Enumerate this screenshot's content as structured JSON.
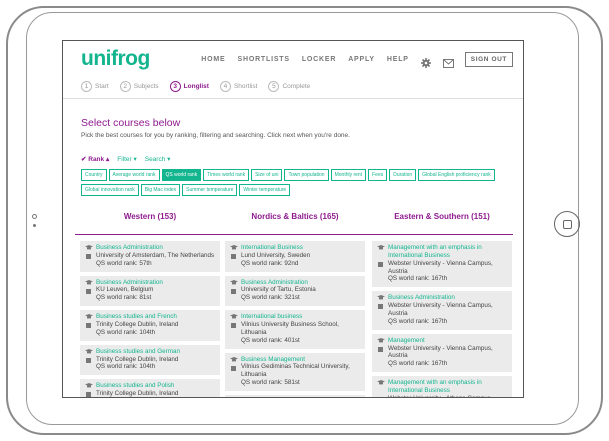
{
  "app": {
    "logo": "unifrog",
    "accent_color": "#13b58f",
    "secondary_color": "#8e1b8e"
  },
  "nav": {
    "items": [
      "HOME",
      "SHORTLISTS",
      "LOCKER",
      "APPLY",
      "HELP"
    ],
    "icons": [
      "gear-icon",
      "mail-icon"
    ],
    "signout": "SIGN OUT"
  },
  "steps": [
    {
      "num": "1",
      "label": "Start"
    },
    {
      "num": "2",
      "label": "Subjects"
    },
    {
      "num": "3",
      "label": "Longlist",
      "active": true
    },
    {
      "num": "4",
      "label": "Shortlist"
    },
    {
      "num": "5",
      "label": "Complete"
    }
  ],
  "main": {
    "heading": "Select courses below",
    "subheading": "Pick the best courses for you by ranking, filtering and searching. Click next when you're done."
  },
  "filters": [
    {
      "label": "✔ Rank ▴",
      "active": true
    },
    {
      "label": "Filter ▾"
    },
    {
      "label": "Search ▾"
    }
  ],
  "tags": [
    {
      "label": "Country"
    },
    {
      "label": "Average world rank"
    },
    {
      "label": "QS world rank",
      "selected": true
    },
    {
      "label": "Times world rank"
    },
    {
      "label": "Size of uni"
    },
    {
      "label": "Town population"
    },
    {
      "label": "Monthly rent"
    },
    {
      "label": "Fees"
    },
    {
      "label": "Duration"
    },
    {
      "label": "Global English proficiency rank"
    },
    {
      "label": "Global innovation rank"
    },
    {
      "label": "Big Mac index"
    },
    {
      "label": "Summer temperature"
    },
    {
      "label": "Winter temperature"
    }
  ],
  "columns": [
    {
      "header": "Western (153)",
      "cards": [
        {
          "title": "Business Administration",
          "uni": "University of Amsterdam, The Netherlands",
          "rank": "QS world rank: 57th"
        },
        {
          "title": "Business Administration",
          "uni": "KU Leuven, Belgium",
          "rank": "QS world rank: 81st"
        },
        {
          "title": "Business studies and French",
          "uni": "Trinity College Dublin, Ireland",
          "rank": "QS world rank: 104th"
        },
        {
          "title": "Business studies and German",
          "uni": "Trinity College Dublin, Ireland",
          "rank": "QS world rank: 104th"
        },
        {
          "title": "Business studies and Polish",
          "uni": "Trinity College Dublin, Ireland",
          "rank": "QS world rank: 104th"
        }
      ]
    },
    {
      "header": "Nordics & Baltics (165)",
      "cards": [
        {
          "title": "International Business",
          "uni": "Lund University, Sweden",
          "rank": "QS world rank: 92nd"
        },
        {
          "title": "Business Administration",
          "uni": "University of Tartu, Estonia",
          "rank": "QS world rank: 321st"
        },
        {
          "title": "International business",
          "uni": "Vilnius University Business School, Lithuania",
          "rank": "QS world rank: 401st"
        },
        {
          "title": "Business Management",
          "uni": "Vilnius Gediminas Technical University, Lithuania",
          "rank": "QS world rank: 581st"
        },
        {
          "title": "International Business Administration",
          "uni": "",
          "rank": ""
        }
      ]
    },
    {
      "header": "Eastern & Southern (151)",
      "cards": [
        {
          "title": "Management with an emphasis in International Business",
          "uni": "Webster University - Vienna Campus, Austria",
          "rank": "QS world rank: 167th"
        },
        {
          "title": "Business Administration",
          "uni": "Webster University - Vienna Campus, Austria",
          "rank": "QS world rank: 167th"
        },
        {
          "title": "Management",
          "uni": "Webster University - Vienna Campus, Austria",
          "rank": "QS world rank: 167th"
        },
        {
          "title": "Management with an emphasis in International Business",
          "uni": "Webster University - Athens Campus, Greece",
          "rank": ""
        }
      ]
    }
  ]
}
